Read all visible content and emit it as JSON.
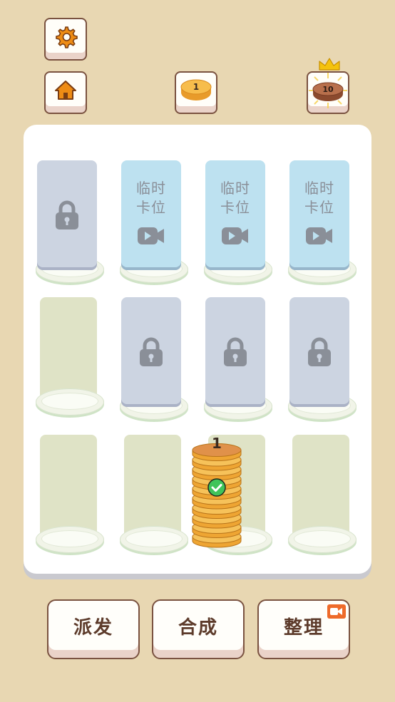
{
  "top_bar": {
    "settings_icon": "gear-icon",
    "home_icon": "home-icon",
    "current_coin": {
      "value": "1",
      "icon": "coin-icon"
    },
    "target_coin": {
      "value": "10",
      "icon": "coin-icon",
      "badge": "crown-icon"
    }
  },
  "board": {
    "temp_slot_label_line1": "临时",
    "temp_slot_label_line2": "卡位",
    "rows": [
      [
        "locked",
        "temporary-video",
        "temporary-video",
        "temporary-video"
      ],
      [
        "empty",
        "locked",
        "locked",
        "locked"
      ],
      [
        "empty",
        "empty",
        "coin-stack",
        "empty"
      ]
    ],
    "coin_stack": {
      "top_value": "1",
      "selected": true
    }
  },
  "actions": {
    "deal_label": "派发",
    "merge_label": "合成",
    "sort_label": "整理",
    "sort_badge": "video-ad-icon"
  },
  "colors": {
    "background": "#e8d7b2",
    "board": "#ffffff",
    "button_border": "#7a5240",
    "button_text": "#5d3b2b",
    "temp_card": "#bde1f0",
    "locked_card": "#ccd4e1",
    "coin": "#f3b43c",
    "check": "#3fc45a",
    "ad_badge": "#ee6a2a"
  }
}
